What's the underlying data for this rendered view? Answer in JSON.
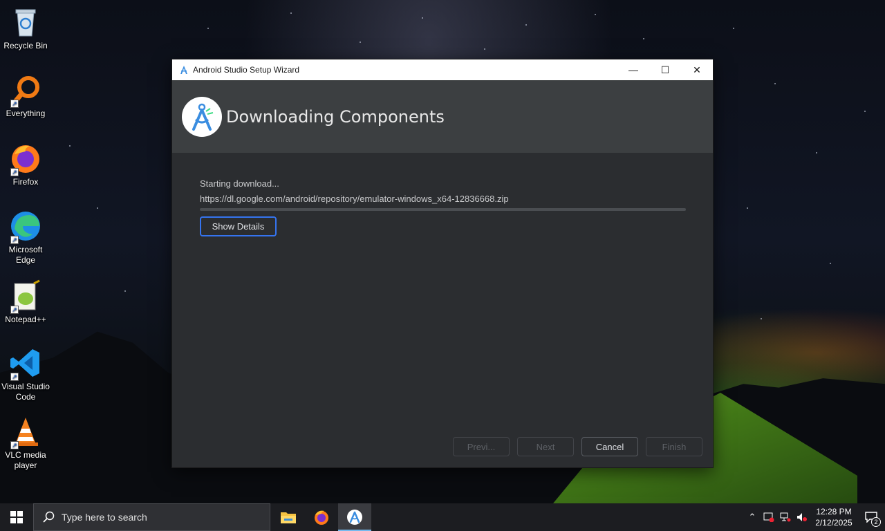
{
  "desktop": {
    "icons": [
      {
        "label": "Recycle Bin",
        "icon": "recycle-bin-icon"
      },
      {
        "label": "Everything",
        "icon": "everything-search-icon"
      },
      {
        "label": "Firefox",
        "icon": "firefox-icon"
      },
      {
        "label": "Microsoft Edge",
        "icon": "edge-icon"
      },
      {
        "label": "Notepad++",
        "icon": "notepadpp-icon"
      },
      {
        "label": "Visual Studio Code",
        "icon": "vscode-icon"
      },
      {
        "label": "VLC media player",
        "icon": "vlc-icon"
      }
    ]
  },
  "window": {
    "title": "Android Studio Setup Wizard",
    "controls": {
      "minimize": "—",
      "maximize": "☐",
      "close": "✕"
    },
    "header_title": "Downloading Components",
    "status_text": "Starting download...",
    "download_url": "https://dl.google.com/android/repository/emulator-windows_x64-12836668.zip",
    "progress_percent": 0,
    "show_details_label": "Show Details",
    "buttons": {
      "previous": "Previ...",
      "next": "Next",
      "cancel": "Cancel",
      "finish": "Finish"
    }
  },
  "taskbar": {
    "search_placeholder": "Type here to search",
    "time": "12:28 PM",
    "date": "2/12/2025",
    "notification_count": "2"
  },
  "colors": {
    "accent": "#3574f0",
    "dialog_bg": "#2b2d30",
    "header_bg": "#3c3f41",
    "taskbar_bg": "#1c1d21"
  }
}
